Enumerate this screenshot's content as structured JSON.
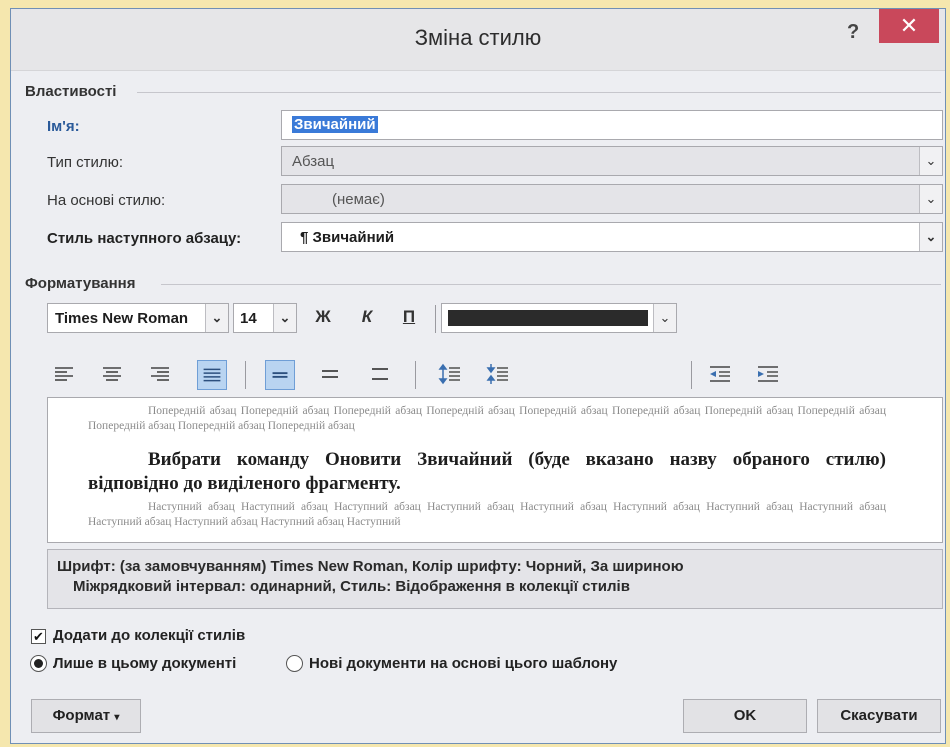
{
  "dialog": {
    "title": "Зміна стилю",
    "help_label": "?",
    "close_label": "✕"
  },
  "properties": {
    "section_label": "Властивості",
    "name_label": "Ім'я:",
    "name_value": "Звичайний",
    "style_type_label": "Тип стилю:",
    "style_type_value": "Абзац",
    "based_on_label": "На основі стилю:",
    "based_on_value": "(немає)",
    "next_style_label": "Стиль наступного абзацу:",
    "next_style_value": "¶ Звичайний"
  },
  "formatting": {
    "section_label": "Форматування",
    "font_name": "Times New Roman",
    "font_size": "14",
    "bold_label": "Ж",
    "italic_label": "К",
    "underline_label": "П",
    "font_color": "#2b2b2b"
  },
  "preview": {
    "previous_text": "Попередній абзац Попередній абзац Попередній абзац Попередній абзац Попередній абзац Попередній абзац Попередній абзац Попередній абзац Попередній абзац Попередній абзац Попередній абзац",
    "main_text": "Вибрати команду Оновити Звичайний (буде вказано назву обраного стилю) відповідно до виділеного фрагменту.",
    "next_text": "Наступний абзац Наступний абзац Наступний абзац Наступний абзац Наступний абзац Наступний абзац Наступний абзац Наступний абзац Наступний абзац Наступний абзац Наступний абзац Наступний"
  },
  "description": {
    "line1": "Шрифт: (за замовчуванням) Times New Roman, Колір шрифту: Чорний, За шириною",
    "line2": "Міжрядковий інтервал:  одинарний, Стиль: Відображення в колекції стилів"
  },
  "options": {
    "add_to_gallery_label": "Додати до колекції стилів",
    "add_to_gallery_checked": true,
    "only_this_doc_label": "Лише в цьому документі",
    "new_docs_label": "Нові документи на основі цього шаблону",
    "selected": "only_this_doc"
  },
  "buttons": {
    "format_label": "Формат",
    "ok_label": "OK",
    "cancel_label": "Скасувати"
  },
  "colors": {
    "close_button": "#c9485b",
    "name_highlight": "#3a7ad8",
    "active_align": "#b9d4f1"
  }
}
